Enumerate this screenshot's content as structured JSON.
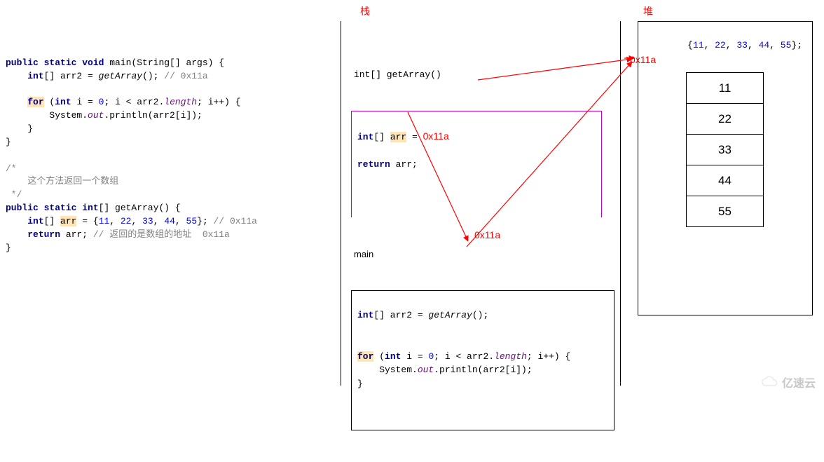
{
  "labels": {
    "stack": "栈",
    "heap": "堆",
    "getArrayTitle": "int[] getArray()",
    "mainTitle": "main"
  },
  "code": {
    "main_sig_1": "public static void",
    "main_sig_2": " main(String[] args) {",
    "arr2_decl_1": "int",
    "arr2_decl_2": "[] arr2 = ",
    "arr2_decl_3": "getArray",
    "arr2_decl_4": "(); ",
    "arr2_decl_cmt": "// 0x11a",
    "for_1": "for",
    "for_2": " (",
    "for_3": "int",
    "for_4": " i = ",
    "for_5": "0",
    "for_6": "; i < arr2.",
    "for_len": "length",
    "for_7": "; i++) {",
    "println_1": "        System.",
    "println_out": "out",
    "println_2": ".println(arr2[i]);",
    "close1": "    }",
    "close2": "}",
    "blockcmt1": "/*",
    "blockcmt2": "    这个方法返回一个数组",
    "blockcmt3": " */",
    "ga_sig_1": "public static int",
    "ga_sig_2": "[] getArray() {",
    "ga_arr_1": "int",
    "ga_arr_2": "[] ",
    "ga_arr_name": "arr",
    "ga_arr_3": " = {",
    "ga_v1": "11",
    "ga_c": ", ",
    "ga_v2": "22",
    "ga_v3": "33",
    "ga_v4": "44",
    "ga_v5": "55",
    "ga_arr_4": "}; ",
    "ga_arr_cmt": "// 0x11a",
    "ga_ret_1": "return",
    "ga_ret_2": " arr; ",
    "ga_ret_cmt": "// 返回的是数组的地址  0x11a"
  },
  "stack": {
    "ga_line1a": "int",
    "ga_line1b": "[] ",
    "ga_line1c": "arr",
    "ga_line1d": " = ",
    "ga_ret1": "return",
    "ga_ret2": " arr;",
    "main_line1a": "int",
    "main_line1b": "[] arr2 = ",
    "main_line1c": "getArray",
    "main_line1d": "();",
    "main_for1": "for",
    "main_for2": " (",
    "main_for3": "int",
    "main_for4": " i = ",
    "main_for5": "0",
    "main_for6": "; i < arr2.",
    "main_for_len": "length",
    "main_for7": "; i++) {",
    "main_println1": "    System.",
    "main_println_out": "out",
    "main_println2": ".println(arr2[i]);",
    "main_close": "}"
  },
  "heap": {
    "literal_open": "{",
    "v1": "11",
    "c": ", ",
    "v2": "22",
    "v3": "33",
    "v4": "44",
    "v5": "55",
    "literal_close": "};",
    "address": "0x11a",
    "cells": [
      "11",
      "22",
      "33",
      "44",
      "55"
    ]
  },
  "annotations": {
    "arr_addr": "0x11a",
    "arr2_addr": "0x11a"
  },
  "watermark": "亿速云"
}
